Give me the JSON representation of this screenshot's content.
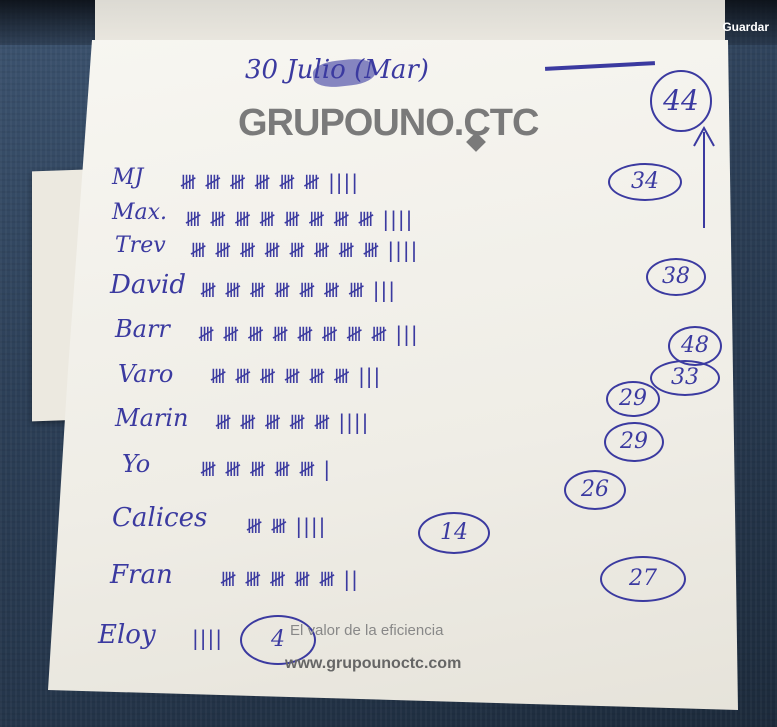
{
  "top_bar": {
    "save_label": "Guardar"
  },
  "note": {
    "date": "30 Julio (Mar)",
    "header_total": "44",
    "brand": "GRUPOUNO.CTC",
    "tagline": "El valor de la eficiencia",
    "website": "www.grupounoctc.com",
    "rows": [
      {
        "name": "MJ",
        "tally": "𝍸 𝍸 𝍸 𝍸 𝍸 𝍸 ||||",
        "total": "34"
      },
      {
        "name": "Max.",
        "tally": "𝍸 𝍸 𝍸 𝍸 𝍸 𝍸 𝍸 𝍸 ||||",
        "total": ""
      },
      {
        "name": "Trev",
        "tally": "𝍸 𝍸 𝍸 𝍸 𝍸 𝍸 𝍸 𝍸 ||||",
        "total": ""
      },
      {
        "name": "David",
        "tally": "𝍸 𝍸 𝍸 𝍸 𝍸 𝍸 𝍸 |||",
        "total": "38"
      },
      {
        "name": "Barr",
        "tally": "𝍸 𝍸 𝍸 𝍸 𝍸 𝍸 𝍸 𝍸 |||",
        "total": "48"
      },
      {
        "name": "Varo",
        "tally": "𝍸 𝍸 𝍸 𝍸 𝍸 𝍸 |||",
        "total": "33"
      },
      {
        "name": "Marin",
        "tally": "𝍸 𝍸 𝍸 𝍸 𝍸 ||||",
        "total": "29"
      },
      {
        "name": "",
        "tally": "",
        "total": "29"
      },
      {
        "name": "Yo",
        "tally": "𝍸 𝍸 𝍸 𝍸 𝍸 |",
        "total": "26"
      },
      {
        "name": "Calices",
        "tally": "𝍸 𝍸 ||||",
        "total": "14"
      },
      {
        "name": "Fran",
        "tally": "𝍸 𝍸 𝍸 𝍸 𝍸 ||",
        "total": "27"
      },
      {
        "name": "Eloy",
        "tally": "||||",
        "total": "4"
      }
    ]
  },
  "colors": {
    "ink": "#3b3aa0",
    "paper": "#f4f2ec",
    "fabric": "#2c3f57"
  }
}
